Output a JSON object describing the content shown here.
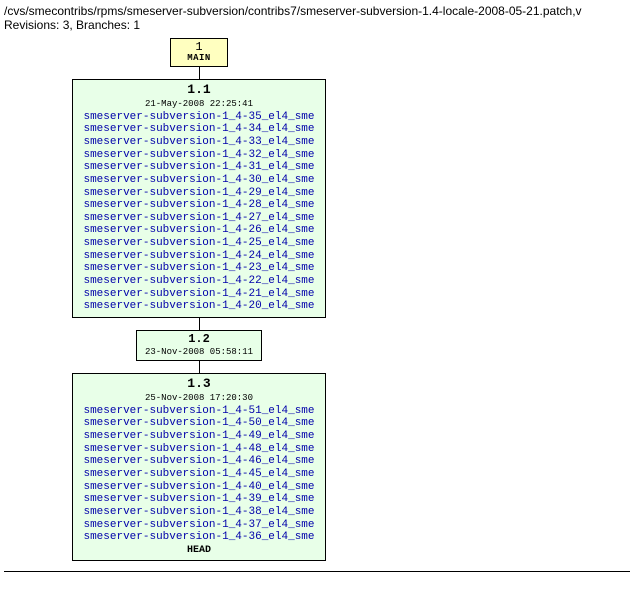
{
  "header": {
    "path": "/cvs/smecontribs/rpms/smeserver-subversion/contribs7/smeserver-subversion-1.4-locale-2008-05-21.patch,v",
    "meta": "Revisions: 3, Branches: 1"
  },
  "branch": {
    "num": "1",
    "name": "MAIN"
  },
  "revisions": [
    {
      "num": "1.1",
      "date": "21-May-2008 22:25:41",
      "tags": [
        "smeserver-subversion-1_4-35_el4_sme",
        "smeserver-subversion-1_4-34_el4_sme",
        "smeserver-subversion-1_4-33_el4_sme",
        "smeserver-subversion-1_4-32_el4_sme",
        "smeserver-subversion-1_4-31_el4_sme",
        "smeserver-subversion-1_4-30_el4_sme",
        "smeserver-subversion-1_4-29_el4_sme",
        "smeserver-subversion-1_4-28_el4_sme",
        "smeserver-subversion-1_4-27_el4_sme",
        "smeserver-subversion-1_4-26_el4_sme",
        "smeserver-subversion-1_4-25_el4_sme",
        "smeserver-subversion-1_4-24_el4_sme",
        "smeserver-subversion-1_4-23_el4_sme",
        "smeserver-subversion-1_4-22_el4_sme",
        "smeserver-subversion-1_4-21_el4_sme",
        "smeserver-subversion-1_4-20_el4_sme"
      ],
      "head": ""
    },
    {
      "num": "1.2",
      "date": "23-Nov-2008 05:58:11",
      "tags": [],
      "head": "",
      "small": true
    },
    {
      "num": "1.3",
      "date": "25-Nov-2008 17:20:30",
      "tags": [
        "smeserver-subversion-1_4-51_el4_sme",
        "smeserver-subversion-1_4-50_el4_sme",
        "smeserver-subversion-1_4-49_el4_sme",
        "smeserver-subversion-1_4-48_el4_sme",
        "smeserver-subversion-1_4-46_el4_sme",
        "smeserver-subversion-1_4-45_el4_sme",
        "smeserver-subversion-1_4-40_el4_sme",
        "smeserver-subversion-1_4-39_el4_sme",
        "smeserver-subversion-1_4-38_el4_sme",
        "smeserver-subversion-1_4-37_el4_sme",
        "smeserver-subversion-1_4-36_el4_sme"
      ],
      "head": "HEAD"
    }
  ]
}
